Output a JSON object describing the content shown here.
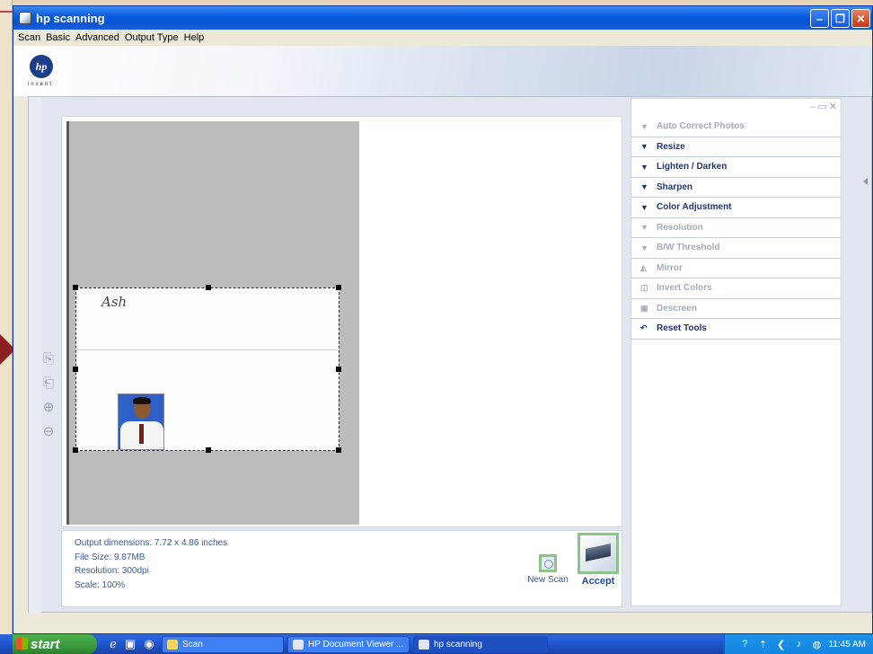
{
  "window": {
    "title": "hp scanning",
    "controls": [
      "minimize",
      "maximize",
      "close"
    ]
  },
  "menu": [
    "Scan",
    "Basic",
    "Advanced",
    "Output Type",
    "Help"
  ],
  "branding": {
    "logo_text": "hp",
    "tagline": "invent"
  },
  "preview": {
    "signature_text": "Ash"
  },
  "info": {
    "output_dimensions": "Output dimensions: 7.72 x 4.86 inches",
    "file_size": "File Size: 9.87MB",
    "resolution": "Resolution:  300dpi",
    "scale": "Scale: 100%"
  },
  "actions": {
    "new_scan": "New Scan",
    "accept": "Accept"
  },
  "tools": [
    {
      "label": "Auto Correct Photos",
      "enabled": false,
      "icon": "triangle-down-icon"
    },
    {
      "label": "Resize",
      "enabled": true,
      "icon": "triangle-down-icon"
    },
    {
      "label": "Lighten / Darken",
      "enabled": true,
      "icon": "triangle-down-icon"
    },
    {
      "label": "Sharpen",
      "enabled": true,
      "icon": "triangle-down-icon"
    },
    {
      "label": "Color Adjustment",
      "enabled": true,
      "icon": "triangle-down-icon"
    },
    {
      "label": "Resolution",
      "enabled": false,
      "icon": "triangle-down-icon"
    },
    {
      "label": "B/W Threshold",
      "enabled": false,
      "icon": "triangle-down-icon"
    },
    {
      "label": "Mirror",
      "enabled": false,
      "icon": "mirror-icon"
    },
    {
      "label": "Invert Colors",
      "enabled": false,
      "icon": "invert-icon"
    },
    {
      "label": "Descreen",
      "enabled": false,
      "icon": "descreen-icon"
    },
    {
      "label": "Reset Tools",
      "enabled": true,
      "icon": "undo-icon"
    }
  ],
  "taskbar": {
    "start": "start",
    "buttons": [
      "Scan",
      "HP Document Viewer ...",
      "hp scanning"
    ],
    "clock": "11:45 AM"
  },
  "colors": {
    "title_blue": "#0a5ce0",
    "accent_green": "#8dc38b",
    "label_blue": "#3b5a9b",
    "tool_enabled": "#23356e",
    "tool_disabled": "#a6acba"
  }
}
